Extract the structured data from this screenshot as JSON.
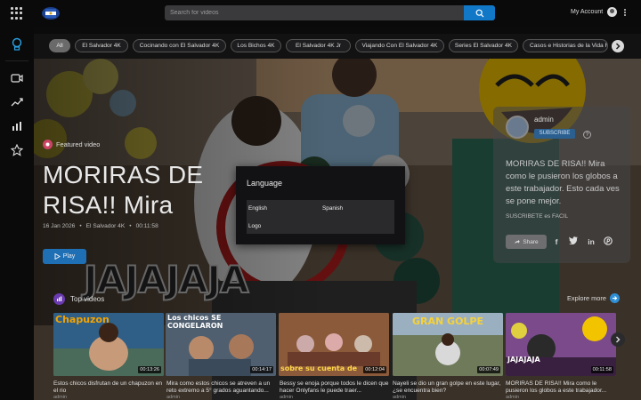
{
  "header": {
    "search_placeholder": "Search for videos",
    "account_label": "My Account"
  },
  "sidebar": {
    "items": [
      "lightbulb",
      "video",
      "trending",
      "bar-chart",
      "star"
    ]
  },
  "chips": {
    "items": [
      "All",
      "El Salvador 4K",
      "Cocinando con El Salvador 4K",
      "Los Bichos 4K",
      "El Salvador 4K Jr",
      "Viajando Con El Salvador 4K",
      "Series El Salvador 4K",
      "Casos e Historias de la Vida R"
    ],
    "active_index": 0
  },
  "hero": {
    "featured_label": "Featured video",
    "title": "MORIRAS DE RISA!! Mira",
    "date": "16 Jan 2026",
    "channel": "El Salvador 4K",
    "duration": "00:11:58",
    "play_label": "Play",
    "thumb_caption": "JAJAJAJA"
  },
  "channel_card": {
    "name": "admin",
    "subscribe_label": "SUBSCRIBE",
    "help": "?",
    "description": "MORIRAS DE RISA!! Mira como le pusieron los globos a este trabajador. Esto cada ves se pone mejor.",
    "subtitle": "SUSCRIBETE es FACIL",
    "share_label": "Share"
  },
  "top_videos": {
    "heading": "Top videos",
    "explore_label": "Explore more",
    "items": [
      {
        "title": "Estos chicos disfrutan de un chapuzon en el rio",
        "author": "admin",
        "duration": "00:13:26",
        "caption": "Chapuzon",
        "color": "#3b6f9a"
      },
      {
        "title": "Mira como estos chicos se atreven a un reto extremo a 5° grados aguantando...",
        "author": "admin",
        "duration": "00:14:17",
        "caption": "Los chicos SE CONGELARON",
        "color": "#5a6b7c"
      },
      {
        "title": "Bessy se enoja porque todos le dicen que hacer Onlyfans le puede traer...",
        "author": "admin",
        "duration": "00:12:04",
        "caption": "sobre su cuenta de",
        "color": "#9a6a4a"
      },
      {
        "title": "Nayeli se dio un gran golpe en este lugar, ¿se encuentra bien?",
        "author": "admin",
        "duration": "00:07:49",
        "caption": "GRAN GOLPE",
        "color": "#7a8a6a"
      },
      {
        "title": "MORIRAS DE RISA!! Mira como le pusieron los globos a este trabajador...",
        "author": "admin",
        "duration": "00:11:58",
        "caption": "JAJAJAJA",
        "color": "#8a5aa0"
      }
    ]
  },
  "modal": {
    "title": "Language",
    "options": [
      "English",
      "Spanish",
      "Logo"
    ]
  },
  "colors": {
    "accent": "#1178c8",
    "subscribe": "#2b5f8f"
  }
}
